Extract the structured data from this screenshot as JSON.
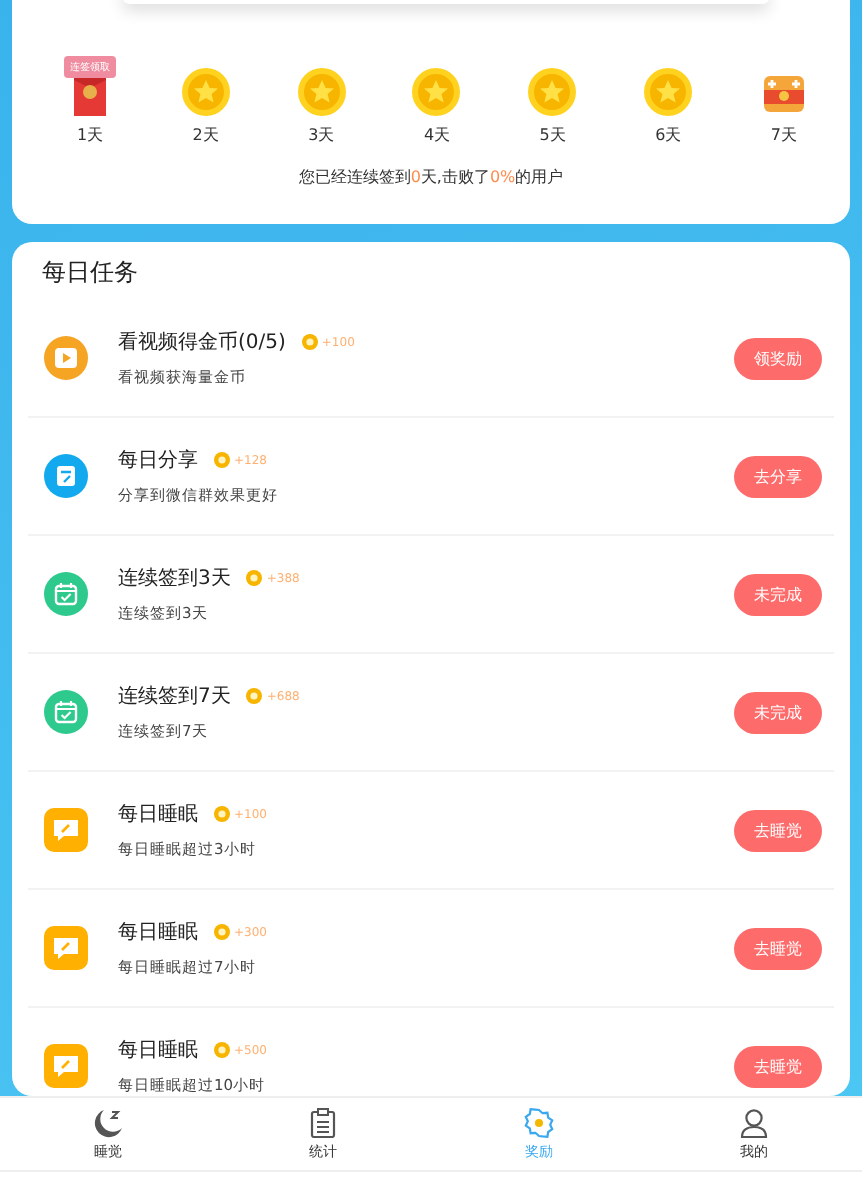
{
  "checkin": {
    "badge": "连签领取",
    "days": [
      {
        "label": "1天",
        "kind": "redpacket"
      },
      {
        "label": "2天",
        "kind": "coin"
      },
      {
        "label": "3天",
        "kind": "coin"
      },
      {
        "label": "4天",
        "kind": "coin"
      },
      {
        "label": "5天",
        "kind": "coin"
      },
      {
        "label": "6天",
        "kind": "coin"
      },
      {
        "label": "7天",
        "kind": "chest"
      }
    ],
    "summary": "您已经连续签到**0**天,击败了**0%**的用户"
  },
  "tasks": {
    "title": "每日任务",
    "items": [
      {
        "kind": "video",
        "title": "看视频得金币(0/5)",
        "reward": "+100",
        "desc": "看视频获海量金币",
        "action": "领奖励"
      },
      {
        "kind": "share",
        "title": "每日分享",
        "reward": "+128",
        "desc": "分享到微信群效果更好",
        "action": "去分享"
      },
      {
        "kind": "calendar",
        "title": "连续签到3天",
        "reward": "+388",
        "desc": "连续签到3天",
        "action": "未完成"
      },
      {
        "kind": "calendar",
        "title": "连续签到7天",
        "reward": "+688",
        "desc": "连续签到7天",
        "action": "未完成"
      },
      {
        "kind": "sleep",
        "title": "每日睡眠",
        "reward": "+100",
        "desc": "每日睡眠超过3小时",
        "action": "去睡觉"
      },
      {
        "kind": "sleep",
        "title": "每日睡眠",
        "reward": "+300",
        "desc": "每日睡眠超过7小时",
        "action": "去睡觉"
      },
      {
        "kind": "sleep",
        "title": "每日睡眠",
        "reward": "+500",
        "desc": "每日睡眠超过10小时",
        "action": "去睡觉"
      }
    ]
  },
  "tabbar": [
    {
      "label": "睡觉",
      "selected": false
    },
    {
      "label": "统计",
      "selected": false
    },
    {
      "label": "奖励",
      "selected": true
    },
    {
      "label": "我的",
      "selected": false
    }
  ]
}
